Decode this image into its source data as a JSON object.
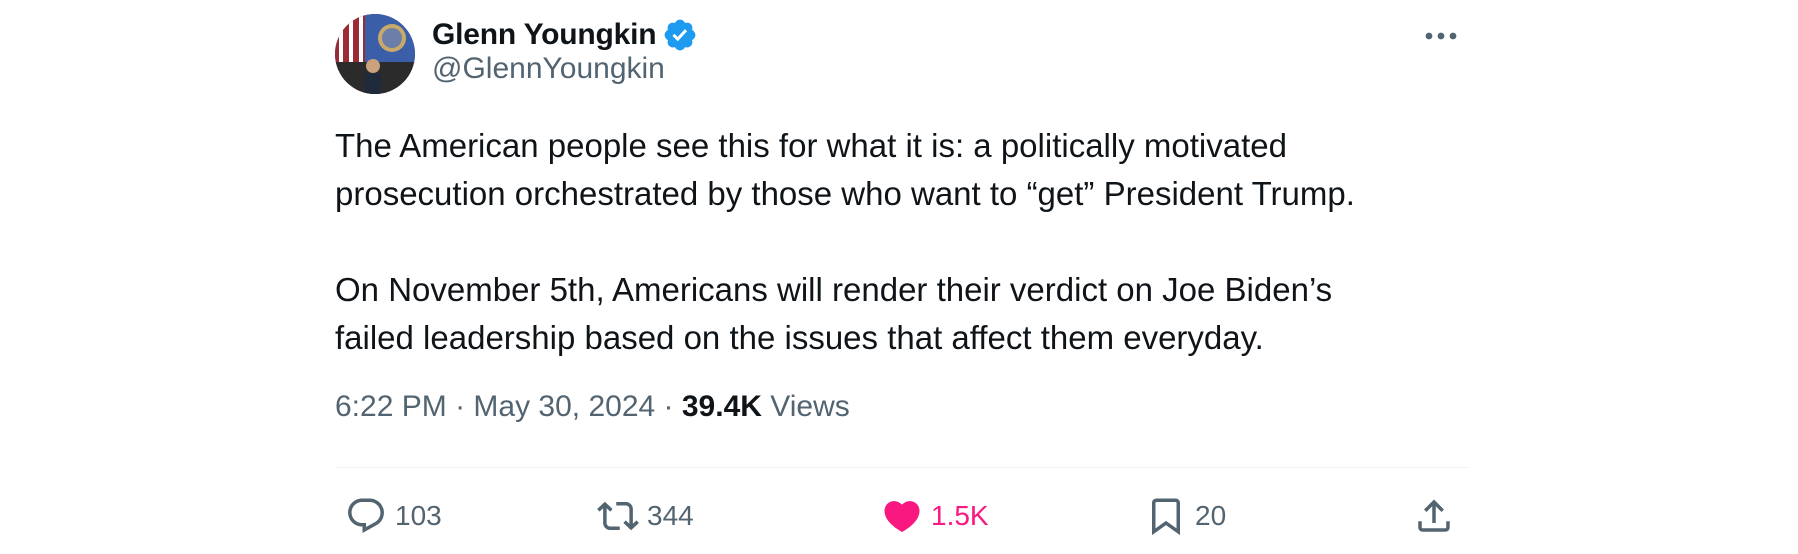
{
  "author": {
    "display_name": "Glenn Youngkin",
    "handle": "@GlennYoungkin",
    "verified_icon": "verified-badge-icon",
    "accent_color": "#1d9bf0"
  },
  "tweet": {
    "paragraphs": [
      "The American people see this for what it is: a politically motivated\nprosecution orchestrated by those who want to “get” President Trump.",
      "On November 5th, Americans will render their verdict on Joe Biden’s\nfailed leadership based on the issues that affect them everyday."
    ],
    "time": "6:22 PM",
    "separator": " · ",
    "date": "May 30, 2024",
    "views_count": "39.4K",
    "views_label": "Views"
  },
  "actions": {
    "replies": "103",
    "reposts": "344",
    "likes": "1.5K",
    "bookmarks": "20",
    "like_color": "#f91880",
    "icon_color": "#536471"
  }
}
